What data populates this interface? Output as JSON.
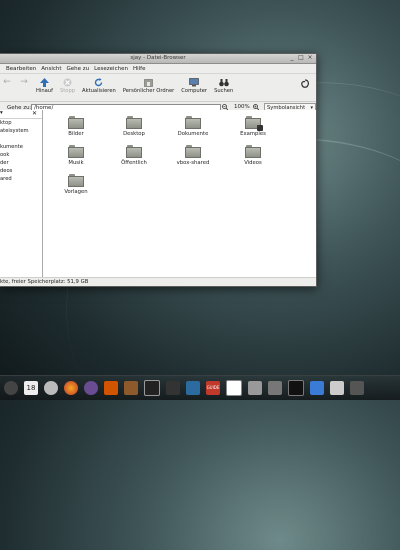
{
  "window": {
    "title": "sjay - Datei-Browser",
    "controls": [
      "_",
      "□",
      "×"
    ]
  },
  "menubar": [
    "Bearbeiten",
    "Ansicht",
    "Gehe zu",
    "Lesezeichen",
    "Hilfe"
  ],
  "toolbar": {
    "back": "←",
    "forward": "→",
    "up_label": "Hinauf",
    "stop_label": "Stopp",
    "reload_label": "Aktualisieren",
    "home_label": "Persönlicher Ordner",
    "computer_label": "Computer",
    "search_label": "Suchen"
  },
  "location": {
    "label": "Gehe zu:",
    "path": "/home/",
    "zoom_value": "100%",
    "view_mode": "Symbolansicht"
  },
  "sidebar": {
    "items": [
      "ktop",
      "ateisystem",
      "kumente",
      "ook",
      "der",
      "deos",
      "ared"
    ]
  },
  "folders": [
    {
      "name": "Bilder"
    },
    {
      "name": "Desktop"
    },
    {
      "name": "Dokumente"
    },
    {
      "name": "Examples"
    },
    {
      "name": "Musik"
    },
    {
      "name": "Öffentlich"
    },
    {
      "name": "vbox-shared"
    },
    {
      "name": "Videos"
    },
    {
      "name": "Vorlagen"
    }
  ],
  "statusbar": {
    "text": "kte, freier Speicherplatz: 51,9 GB"
  },
  "dock": {
    "calendar_day": "18",
    "guide_label": "GUIDE"
  }
}
